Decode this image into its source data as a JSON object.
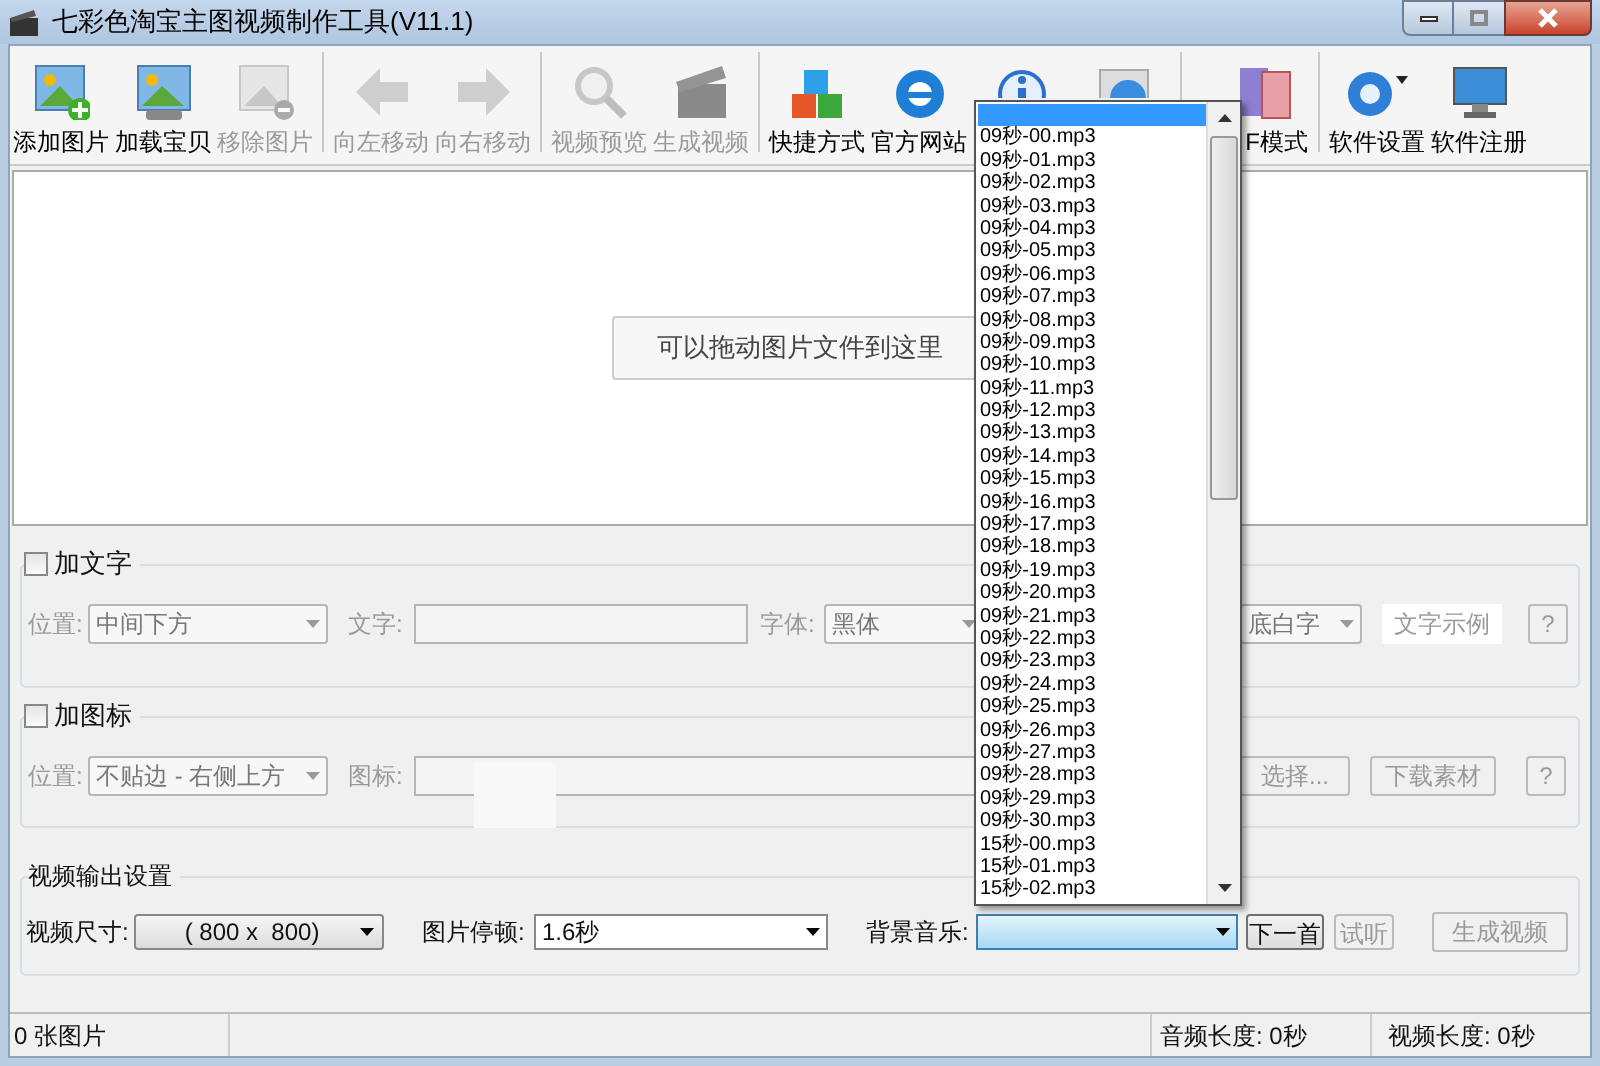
{
  "window": {
    "title": "七彩色淘宝主图视频制作工具(V11.1)"
  },
  "toolbar": [
    {
      "kind": "button",
      "label": "添加图片",
      "disabled": false
    },
    {
      "kind": "button",
      "label": "加载宝贝",
      "disabled": false
    },
    {
      "kind": "button",
      "label": "移除图片",
      "disabled": true
    },
    {
      "kind": "separator"
    },
    {
      "kind": "button",
      "label": "向左移动",
      "disabled": true
    },
    {
      "kind": "button",
      "label": "向右移动",
      "disabled": true
    },
    {
      "kind": "separator"
    },
    {
      "kind": "button",
      "label": "视频预览",
      "disabled": true
    },
    {
      "kind": "button",
      "label": "生成视频",
      "disabled": true
    },
    {
      "kind": "separator"
    },
    {
      "kind": "button",
      "label": "快捷方式",
      "disabled": false
    },
    {
      "kind": "button",
      "label": "官方网站",
      "disabled": false
    },
    {
      "kind": "button",
      "disabled": false
    },
    {
      "kind": "button",
      "disabled": false
    },
    {
      "kind": "separator"
    },
    {
      "kind": "button",
      "label": "F模式",
      "disabled": false
    },
    {
      "kind": "separator"
    },
    {
      "kind": "button",
      "label": "软件设置",
      "disabled": false
    },
    {
      "kind": "button",
      "label": "软件注册",
      "disabled": false
    }
  ],
  "drop_zone": {
    "hint": "可以拖动图片文件到这里"
  },
  "text_group": {
    "label": "加文字",
    "checked": false,
    "position_label": "位置:",
    "position_value": "中间下方",
    "text_label": "文字:",
    "font_label": "字体:",
    "font_value": "黑体",
    "style_value": "底白字",
    "sample": "文字示例",
    "help": "?"
  },
  "icon_group": {
    "label": "加图标",
    "checked": false,
    "position_label": "位置:",
    "position_value": "不贴边 - 右侧上方",
    "icon_label": "图标:",
    "choose": "选择...",
    "download": "下载素材",
    "help": "?"
  },
  "output": {
    "title": "视频输出设置",
    "size_label": "视频尺寸:",
    "size_value": "( 800 x  800)",
    "pause_label": "图片停顿:",
    "pause_value": "1.6秒",
    "music_label": "背景音乐:",
    "next": "下一首",
    "listen": "试听",
    "listen_disabled": true,
    "generate": "生成视频",
    "generate_disabled": true
  },
  "status_bar": {
    "images": "0 张图片",
    "audio": "音频长度: 0秒",
    "video": "视频长度: 0秒"
  },
  "music_list": [
    {
      "selected": true
    },
    {
      "label": "09秒-00.mp3",
      "selected": false
    },
    {
      "label": "09秒-01.mp3",
      "selected": false
    },
    {
      "label": "09秒-02.mp3",
      "selected": false
    },
    {
      "label": "09秒-03.mp3",
      "selected": false
    },
    {
      "label": "09秒-04.mp3",
      "selected": false
    },
    {
      "label": "09秒-05.mp3",
      "selected": false
    },
    {
      "label": "09秒-06.mp3",
      "selected": false
    },
    {
      "label": "09秒-07.mp3",
      "selected": false
    },
    {
      "label": "09秒-08.mp3",
      "selected": false
    },
    {
      "label": "09秒-09.mp3",
      "selected": false
    },
    {
      "label": "09秒-10.mp3",
      "selected": false
    },
    {
      "label": "09秒-11.mp3",
      "selected": false
    },
    {
      "label": "09秒-12.mp3",
      "selected": false
    },
    {
      "label": "09秒-13.mp3",
      "selected": false
    },
    {
      "label": "09秒-14.mp3",
      "selected": false
    },
    {
      "label": "09秒-15.mp3",
      "selected": false
    },
    {
      "label": "09秒-16.mp3",
      "selected": false
    },
    {
      "label": "09秒-17.mp3",
      "selected": false
    },
    {
      "label": "09秒-18.mp3",
      "selected": false
    },
    {
      "label": "09秒-19.mp3",
      "selected": false
    },
    {
      "label": "09秒-20.mp3",
      "selected": false
    },
    {
      "label": "09秒-21.mp3",
      "selected": false
    },
    {
      "label": "09秒-22.mp3",
      "selected": false
    },
    {
      "label": "09秒-23.mp3",
      "selected": false
    },
    {
      "label": "09秒-24.mp3",
      "selected": false
    },
    {
      "label": "09秒-25.mp3",
      "selected": false
    },
    {
      "label": "09秒-26.mp3",
      "selected": false
    },
    {
      "label": "09秒-27.mp3",
      "selected": false
    },
    {
      "label": "09秒-28.mp3",
      "selected": false
    },
    {
      "label": "09秒-29.mp3",
      "selected": false
    },
    {
      "label": "09秒-30.mp3",
      "selected": false
    },
    {
      "label": "15秒-00.mp3",
      "selected": false
    },
    {
      "label": "15秒-01.mp3",
      "selected": false
    },
    {
      "label": "15秒-02.mp3",
      "selected": false
    }
  ]
}
